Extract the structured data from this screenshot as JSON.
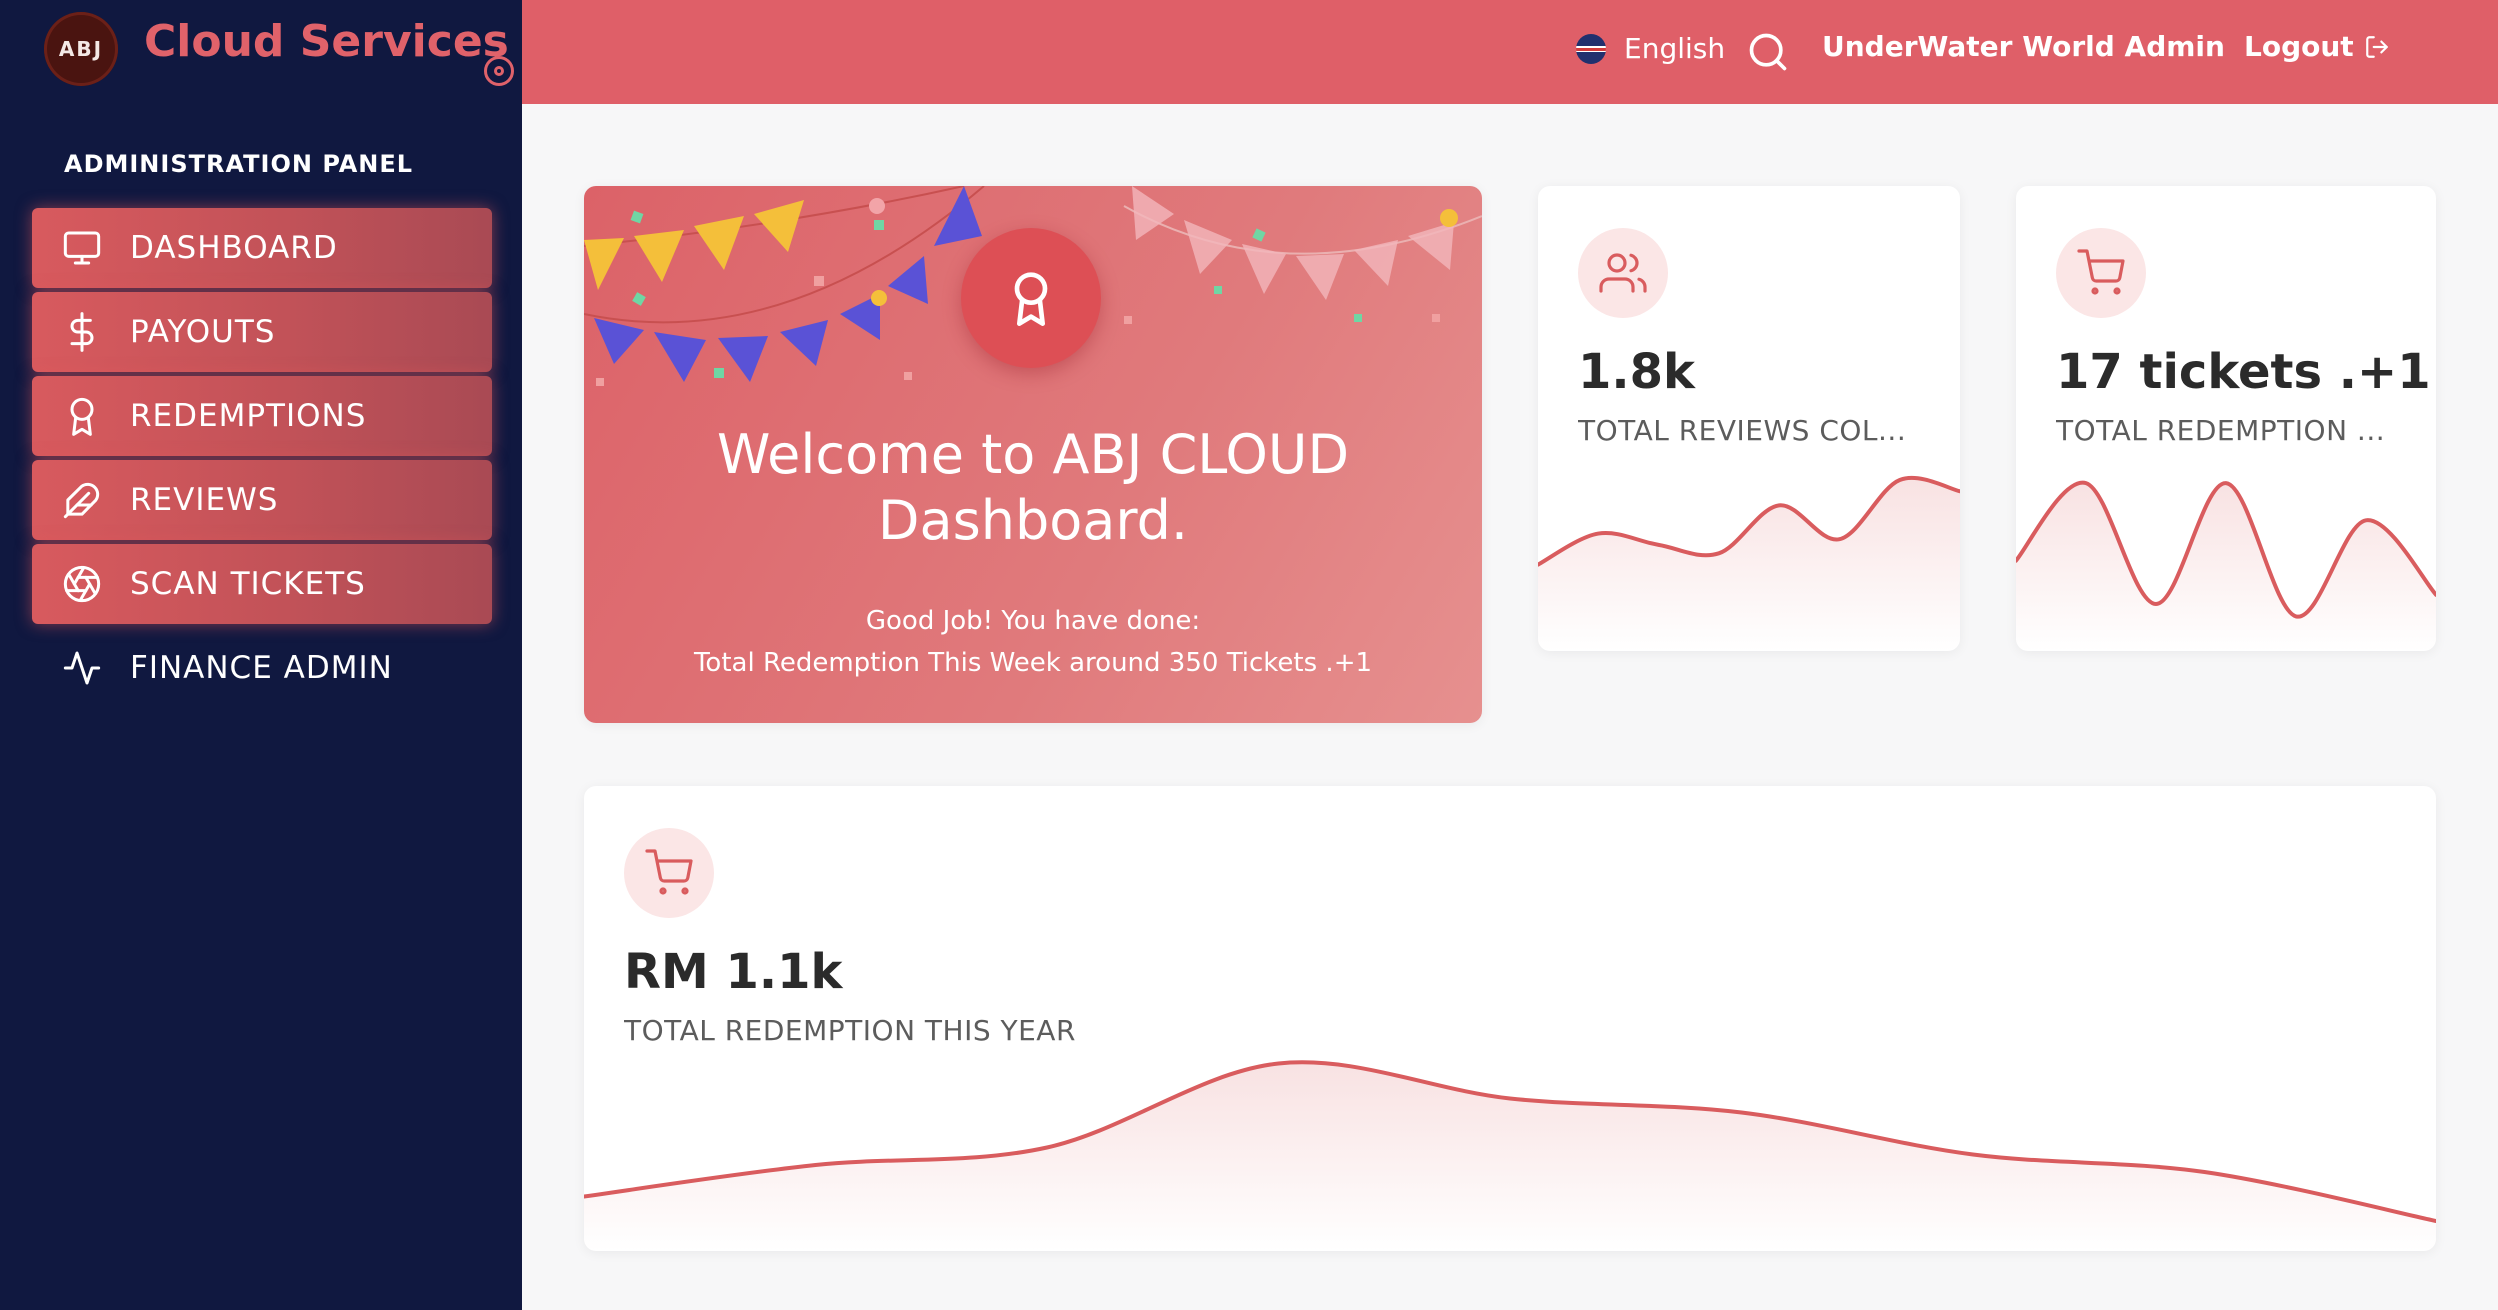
{
  "brand": {
    "logo_text": "ABJ",
    "title": "Cloud Services"
  },
  "sidebar": {
    "heading": "ADMINISTRATION PANEL",
    "items": [
      {
        "label": "DASHBOARD",
        "icon": "monitor-icon",
        "active": true
      },
      {
        "label": "PAYOUTS",
        "icon": "dollar-icon",
        "active": true
      },
      {
        "label": "REDEMPTIONS",
        "icon": "award-icon",
        "active": true
      },
      {
        "label": "REVIEWS",
        "icon": "feather-icon",
        "active": true
      },
      {
        "label": "SCAN TICKETS",
        "icon": "aperture-icon",
        "active": true
      },
      {
        "label": "FINANCE ADMIN",
        "icon": "activity-icon",
        "active": false
      }
    ]
  },
  "topbar": {
    "language": "English",
    "user": "UnderWater World Admin",
    "logout": "Logout"
  },
  "welcome": {
    "title": "Welcome to ABJ CLOUD Dashboard.",
    "line1": "Good Job! You have done:",
    "line2": "Total Redemption This Week around 350 Tickets .+1"
  },
  "stats": {
    "reviews": {
      "value": "1.8k",
      "label": "TOTAL REVIEWS COL...",
      "icon": "users-icon",
      "trend": [
        40,
        62,
        54,
        48,
        82,
        58,
        100,
        92
      ]
    },
    "tickets": {
      "value": "17 tickets .+1",
      "label": "TOTAL REDEMPTION ...",
      "icon": "cart-icon",
      "trend": [
        48,
        98,
        20,
        98,
        12,
        74,
        26
      ]
    },
    "year": {
      "value": "RM 1.1k",
      "label": "TOTAL REDEMPTION THIS YEAR",
      "icon": "cart-icon",
      "trend": [
        22,
        40,
        50,
        98,
        78,
        70,
        46,
        36,
        8
      ]
    }
  },
  "colors": {
    "accent": "#df5f68",
    "sidebar": "#101840",
    "line": "#d95c5e"
  }
}
